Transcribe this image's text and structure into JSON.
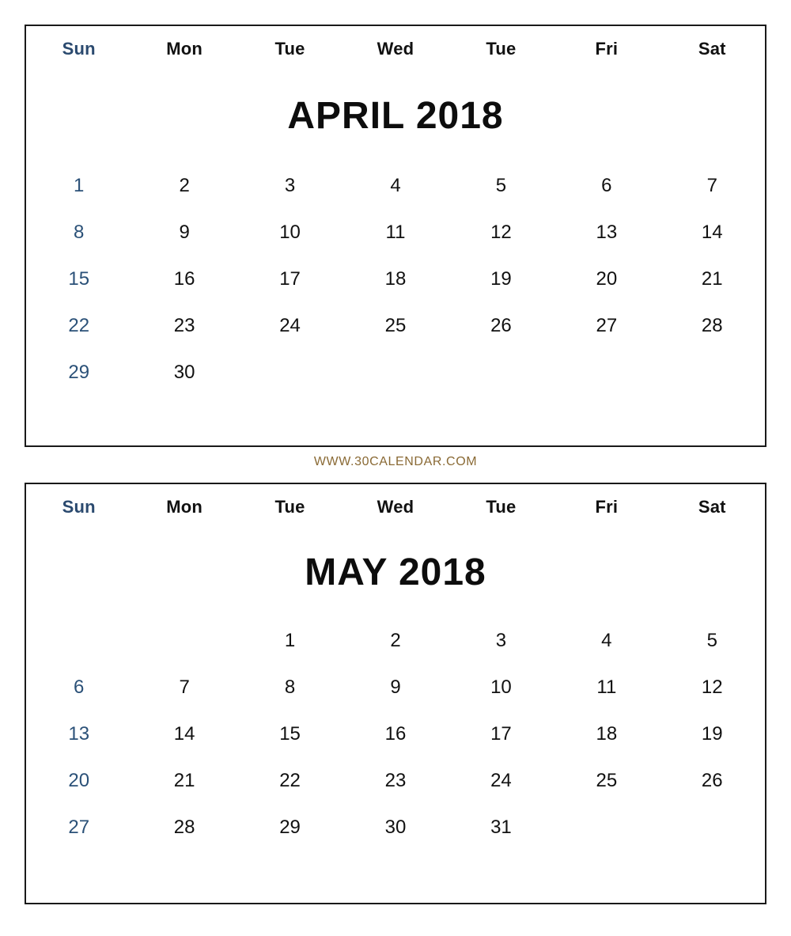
{
  "watermark": {
    "text": "WWW.30CALENDAR.COM",
    "color": "#8a6a35"
  },
  "theme": {
    "sunday_color": "#2b4a6f",
    "text_color": "#111111",
    "border_color": "#1a1a1a",
    "background": "#ffffff"
  },
  "weekday_headers": [
    {
      "label": "Sun"
    },
    {
      "label": "Mon"
    },
    {
      "label": "Tue"
    },
    {
      "label": "Wed"
    },
    {
      "label": "Tue"
    },
    {
      "label": "Fri"
    },
    {
      "label": "Sat"
    }
  ],
  "calendars": [
    {
      "id": "april",
      "title": "APRIL 2018",
      "month": "APRIL",
      "year": "2018",
      "weekday_headers": [
        "Sun",
        "Mon",
        "Tue",
        "Wed",
        "Tue",
        "Fri",
        "Sat"
      ],
      "weeks": [
        [
          "1",
          "2",
          "3",
          "4",
          "5",
          "6",
          "7"
        ],
        [
          "8",
          "9",
          "10",
          "11",
          "12",
          "13",
          "14"
        ],
        [
          "15",
          "16",
          "17",
          "18",
          "19",
          "20",
          "21"
        ],
        [
          "22",
          "23",
          "24",
          "25",
          "26",
          "27",
          "28"
        ],
        [
          "29",
          "30",
          "",
          "",
          "",
          "",
          ""
        ]
      ]
    },
    {
      "id": "may",
      "title": "MAY 2018",
      "month": "MAY",
      "year": "2018",
      "weekday_headers": [
        "Sun",
        "Mon",
        "Tue",
        "Wed",
        "Tue",
        "Fri",
        "Sat"
      ],
      "weeks": [
        [
          "",
          "",
          "1",
          "2",
          "3",
          "4",
          "5"
        ],
        [
          "6",
          "7",
          "8",
          "9",
          "10",
          "11",
          "12"
        ],
        [
          "13",
          "14",
          "15",
          "16",
          "17",
          "18",
          "19"
        ],
        [
          "20",
          "21",
          "22",
          "23",
          "24",
          "25",
          "26"
        ],
        [
          "27",
          "28",
          "29",
          "30",
          "31",
          "",
          ""
        ]
      ]
    }
  ]
}
